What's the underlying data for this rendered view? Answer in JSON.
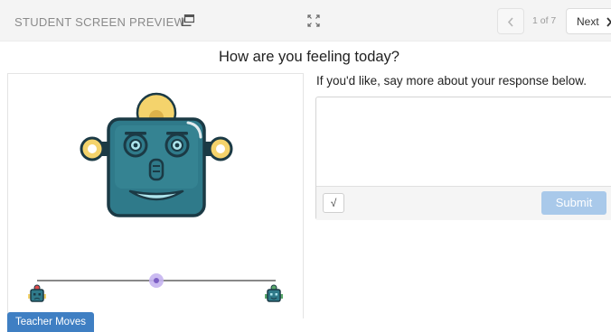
{
  "header": {
    "preview_label": "STUDENT SCREEN PREVIEW",
    "page_count": "1 of 7",
    "next_label": "Next"
  },
  "question": {
    "title": "How are you feeling today?"
  },
  "response": {
    "prompt": "If you'd like, say more about your response below.",
    "value": "",
    "math_button_label": "√",
    "submit_label": "Submit"
  },
  "feeling_slider": {
    "value": 0.5
  },
  "footer": {
    "teacher_moves_label": "Teacher Moves"
  },
  "icons": {
    "preview": "window-icon",
    "expand": "expand-icon",
    "previous": "chevron-left-icon",
    "next": "chevron-right-icon"
  },
  "colors": {
    "robot_body": "#2f7a8a",
    "robot_outline": "#1b3a45",
    "robot_ear": "#f4d36c",
    "slider_thumb": "#9b7ed6",
    "submit_button": "#a9c9ea",
    "teacher_moves": "#3f7fc3"
  }
}
